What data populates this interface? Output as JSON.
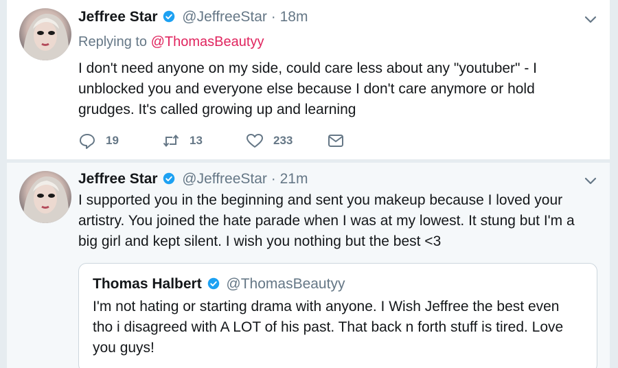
{
  "tweets": [
    {
      "name": "Jeffree Star",
      "handle": "@JeffreeStar",
      "separator": "·",
      "time": "18m",
      "replying_prefix": "Replying to",
      "replying_to": "@ThomasBeautyy",
      "lines": [
        "I don't need anyone on my side, could care less about any \"youtuber\" - I",
        "unblocked you and everyone else because I don't care anymore or hold",
        "grudges. It's called growing up and learning"
      ],
      "replies": "19",
      "retweets": "13",
      "likes": "233"
    },
    {
      "name": "Jeffree Star",
      "handle": "@JeffreeStar",
      "separator": "·",
      "time": "21m",
      "lines": [
        "I supported you in the beginning and sent you makeup because I loved your",
        "artistry. You joined the hate parade when I was at my lowest. It stung but I'm a",
        "big girl and kept silent. I wish you nothing but the best <3"
      ],
      "quote": {
        "name": "Thomas Halbert",
        "handle": "@ThomasBeautyy",
        "lines": [
          "I'm not hating or starting drama with anyone. I Wish Jeffree the best even",
          "tho i disagreed with A LOT of his past. That back n forth stuff is tired. Love",
          "you guys!"
        ]
      }
    }
  ],
  "icons": {
    "verified": "verified-badge-icon",
    "chevron": "chevron-down-icon",
    "reply": "reply-icon",
    "retweet": "retweet-icon",
    "like": "heart-icon",
    "dm": "envelope-icon"
  },
  "colors": {
    "verified": "#1da1f2",
    "mention": "#e0245e",
    "meta": "#657786",
    "background": "#e6ecf0"
  }
}
